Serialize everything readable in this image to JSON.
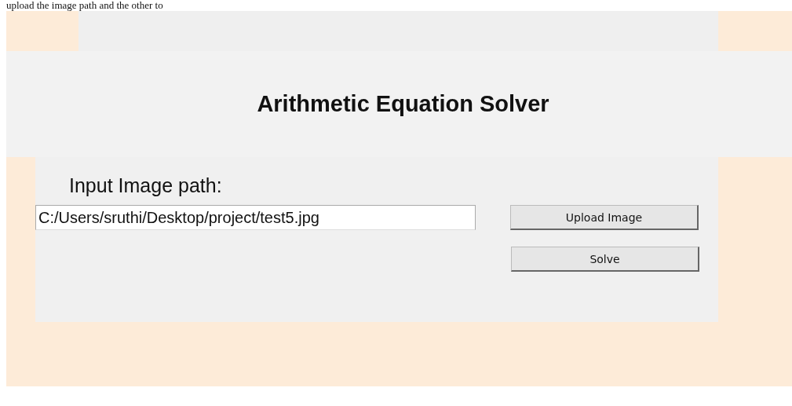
{
  "document_text": "upload the image path and the other to",
  "app": {
    "title": "Arithmetic Equation Solver",
    "path_label": "Input Image path:",
    "path_field": {
      "value": "C:/Users/sruthi/Desktop/project/test5.jpg"
    },
    "buttons": [
      "Upload Image",
      "Solve"
    ]
  }
}
